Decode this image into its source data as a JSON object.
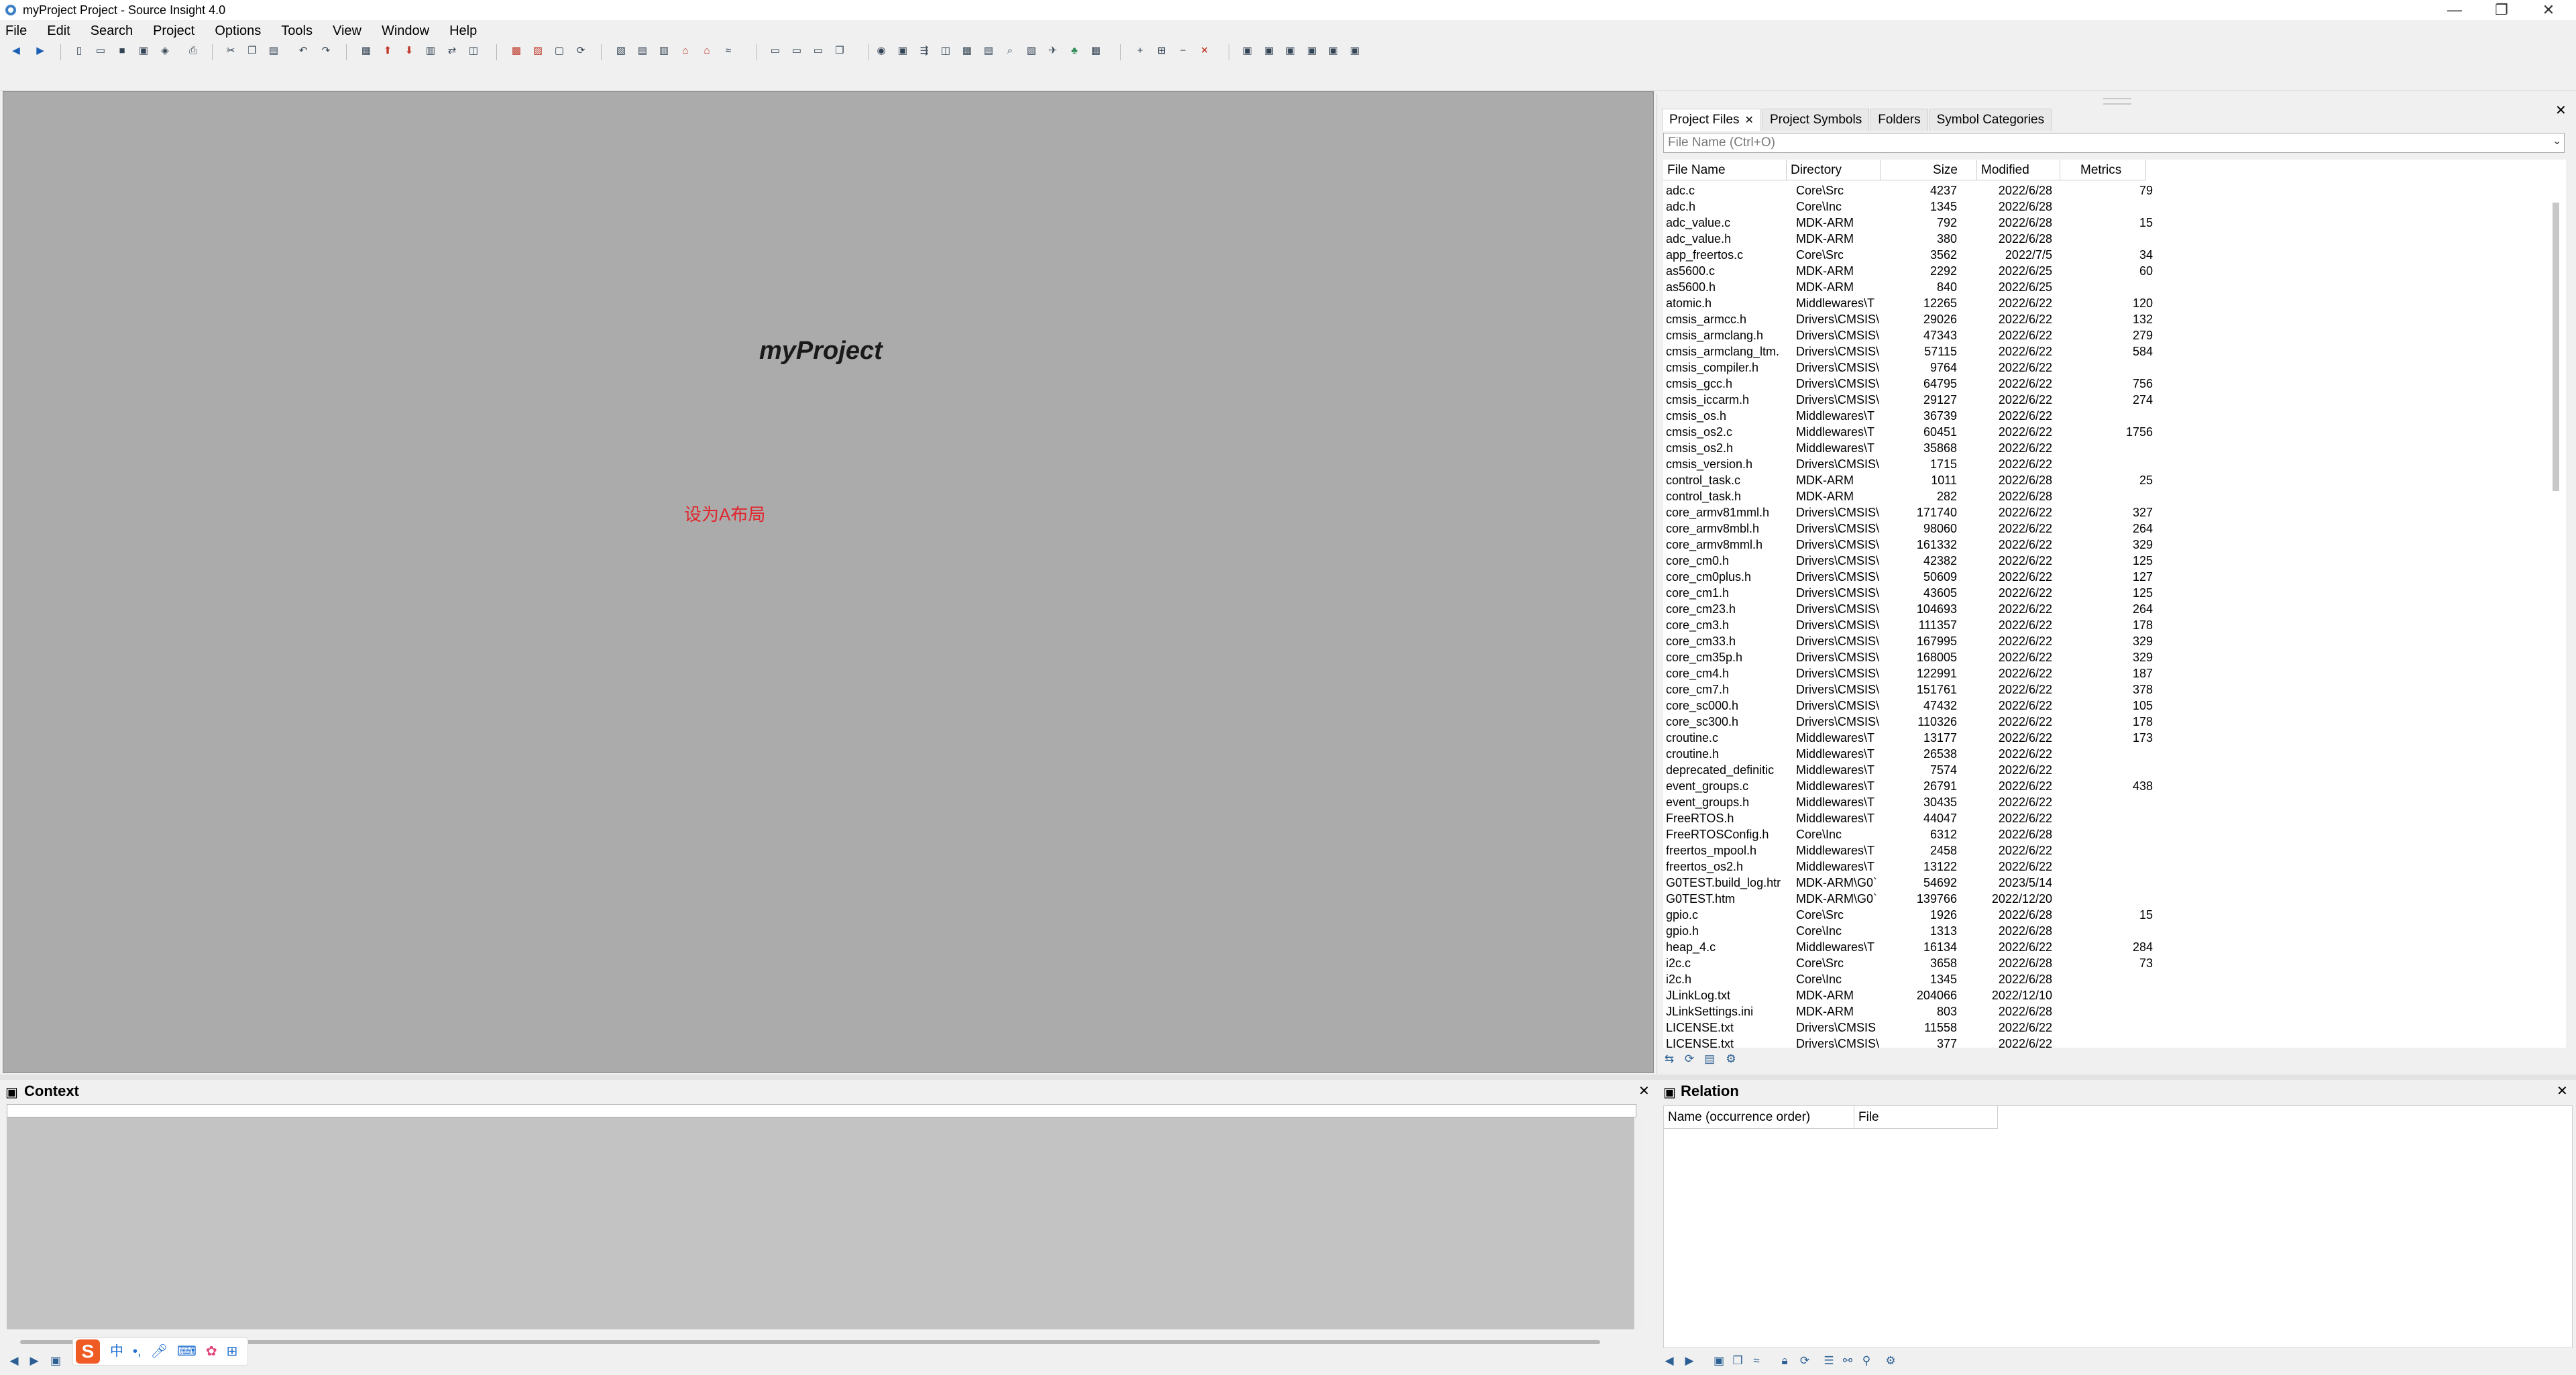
{
  "window": {
    "title": "myProject Project - Source Insight 4.0",
    "controls": {
      "minimize": "—",
      "maximize": "❐",
      "close": "✕"
    }
  },
  "menu": [
    "File",
    "Edit",
    "Search",
    "Project",
    "Options",
    "Tools",
    "View",
    "Window",
    "Help"
  ],
  "editor": {
    "project_name": "myProject",
    "layout_hint": "设为A布局",
    "background": "#ababab",
    "hint_color": "#e1262d"
  },
  "project_window": {
    "tabs": [
      "Project Files",
      "Project Symbols",
      "Folders",
      "Symbol Categories"
    ],
    "active_tab": "Project Files",
    "tab_close": "✕",
    "panel_close": "✕",
    "filter_placeholder": "File Name (Ctrl+O)",
    "columns": [
      "File Name",
      "Directory",
      "Size",
      "Modified",
      "Metrics"
    ],
    "files": [
      {
        "name": "adc.c",
        "dir": "Core\\Src",
        "size": "4237",
        "modified": "2022/6/28",
        "metrics": "79"
      },
      {
        "name": "adc.h",
        "dir": "Core\\Inc",
        "size": "1345",
        "modified": "2022/6/28",
        "metrics": ""
      },
      {
        "name": "adc_value.c",
        "dir": "MDK-ARM",
        "size": "792",
        "modified": "2022/6/28",
        "metrics": "15"
      },
      {
        "name": "adc_value.h",
        "dir": "MDK-ARM",
        "size": "380",
        "modified": "2022/6/28",
        "metrics": ""
      },
      {
        "name": "app_freertos.c",
        "dir": "Core\\Src",
        "size": "3562",
        "modified": "2022/7/5",
        "metrics": "34"
      },
      {
        "name": "as5600.c",
        "dir": "MDK-ARM",
        "size": "2292",
        "modified": "2022/6/25",
        "metrics": "60"
      },
      {
        "name": "as5600.h",
        "dir": "MDK-ARM",
        "size": "840",
        "modified": "2022/6/25",
        "metrics": ""
      },
      {
        "name": "atomic.h",
        "dir": "Middlewares\\T",
        "size": "12265",
        "modified": "2022/6/22",
        "metrics": "120"
      },
      {
        "name": "cmsis_armcc.h",
        "dir": "Drivers\\CMSIS\\",
        "size": "29026",
        "modified": "2022/6/22",
        "metrics": "132"
      },
      {
        "name": "cmsis_armclang.h",
        "dir": "Drivers\\CMSIS\\",
        "size": "47343",
        "modified": "2022/6/22",
        "metrics": "279"
      },
      {
        "name": "cmsis_armclang_ltm.",
        "dir": "Drivers\\CMSIS\\",
        "size": "57115",
        "modified": "2022/6/22",
        "metrics": "584"
      },
      {
        "name": "cmsis_compiler.h",
        "dir": "Drivers\\CMSIS\\",
        "size": "9764",
        "modified": "2022/6/22",
        "metrics": ""
      },
      {
        "name": "cmsis_gcc.h",
        "dir": "Drivers\\CMSIS\\",
        "size": "64795",
        "modified": "2022/6/22",
        "metrics": "756"
      },
      {
        "name": "cmsis_iccarm.h",
        "dir": "Drivers\\CMSIS\\",
        "size": "29127",
        "modified": "2022/6/22",
        "metrics": "274"
      },
      {
        "name": "cmsis_os.h",
        "dir": "Middlewares\\T",
        "size": "36739",
        "modified": "2022/6/22",
        "metrics": ""
      },
      {
        "name": "cmsis_os2.c",
        "dir": "Middlewares\\T",
        "size": "60451",
        "modified": "2022/6/22",
        "metrics": "1756"
      },
      {
        "name": "cmsis_os2.h",
        "dir": "Middlewares\\T",
        "size": "35868",
        "modified": "2022/6/22",
        "metrics": ""
      },
      {
        "name": "cmsis_version.h",
        "dir": "Drivers\\CMSIS\\",
        "size": "1715",
        "modified": "2022/6/22",
        "metrics": ""
      },
      {
        "name": "control_task.c",
        "dir": "MDK-ARM",
        "size": "1011",
        "modified": "2022/6/28",
        "metrics": "25"
      },
      {
        "name": "control_task.h",
        "dir": "MDK-ARM",
        "size": "282",
        "modified": "2022/6/28",
        "metrics": ""
      },
      {
        "name": "core_armv81mml.h",
        "dir": "Drivers\\CMSIS\\",
        "size": "171740",
        "modified": "2022/6/22",
        "metrics": "327"
      },
      {
        "name": "core_armv8mbl.h",
        "dir": "Drivers\\CMSIS\\",
        "size": "98060",
        "modified": "2022/6/22",
        "metrics": "264"
      },
      {
        "name": "core_armv8mml.h",
        "dir": "Drivers\\CMSIS\\",
        "size": "161332",
        "modified": "2022/6/22",
        "metrics": "329"
      },
      {
        "name": "core_cm0.h",
        "dir": "Drivers\\CMSIS\\",
        "size": "42382",
        "modified": "2022/6/22",
        "metrics": "125"
      },
      {
        "name": "core_cm0plus.h",
        "dir": "Drivers\\CMSIS\\",
        "size": "50609",
        "modified": "2022/6/22",
        "metrics": "127"
      },
      {
        "name": "core_cm1.h",
        "dir": "Drivers\\CMSIS\\",
        "size": "43605",
        "modified": "2022/6/22",
        "metrics": "125"
      },
      {
        "name": "core_cm23.h",
        "dir": "Drivers\\CMSIS\\",
        "size": "104693",
        "modified": "2022/6/22",
        "metrics": "264"
      },
      {
        "name": "core_cm3.h",
        "dir": "Drivers\\CMSIS\\",
        "size": "111357",
        "modified": "2022/6/22",
        "metrics": "178"
      },
      {
        "name": "core_cm33.h",
        "dir": "Drivers\\CMSIS\\",
        "size": "167995",
        "modified": "2022/6/22",
        "metrics": "329"
      },
      {
        "name": "core_cm35p.h",
        "dir": "Drivers\\CMSIS\\",
        "size": "168005",
        "modified": "2022/6/22",
        "metrics": "329"
      },
      {
        "name": "core_cm4.h",
        "dir": "Drivers\\CMSIS\\",
        "size": "122991",
        "modified": "2022/6/22",
        "metrics": "187"
      },
      {
        "name": "core_cm7.h",
        "dir": "Drivers\\CMSIS\\",
        "size": "151761",
        "modified": "2022/6/22",
        "metrics": "378"
      },
      {
        "name": "core_sc000.h",
        "dir": "Drivers\\CMSIS\\",
        "size": "47432",
        "modified": "2022/6/22",
        "metrics": "105"
      },
      {
        "name": "core_sc300.h",
        "dir": "Drivers\\CMSIS\\",
        "size": "110326",
        "modified": "2022/6/22",
        "metrics": "178"
      },
      {
        "name": "croutine.c",
        "dir": "Middlewares\\T",
        "size": "13177",
        "modified": "2022/6/22",
        "metrics": "173"
      },
      {
        "name": "croutine.h",
        "dir": "Middlewares\\T",
        "size": "26538",
        "modified": "2022/6/22",
        "metrics": ""
      },
      {
        "name": "deprecated_definitic",
        "dir": "Middlewares\\T",
        "size": "7574",
        "modified": "2022/6/22",
        "metrics": ""
      },
      {
        "name": "event_groups.c",
        "dir": "Middlewares\\T",
        "size": "26791",
        "modified": "2022/6/22",
        "metrics": "438"
      },
      {
        "name": "event_groups.h",
        "dir": "Middlewares\\T",
        "size": "30435",
        "modified": "2022/6/22",
        "metrics": ""
      },
      {
        "name": "FreeRTOS.h",
        "dir": "Middlewares\\T",
        "size": "44047",
        "modified": "2022/6/22",
        "metrics": ""
      },
      {
        "name": "FreeRTOSConfig.h",
        "dir": "Core\\Inc",
        "size": "6312",
        "modified": "2022/6/28",
        "metrics": ""
      },
      {
        "name": "freertos_mpool.h",
        "dir": "Middlewares\\T",
        "size": "2458",
        "modified": "2022/6/22",
        "metrics": ""
      },
      {
        "name": "freertos_os2.h",
        "dir": "Middlewares\\T",
        "size": "13122",
        "modified": "2022/6/22",
        "metrics": ""
      },
      {
        "name": "G0TEST.build_log.htr",
        "dir": "MDK-ARM\\G0`",
        "size": "54692",
        "modified": "2023/5/14",
        "metrics": ""
      },
      {
        "name": "G0TEST.htm",
        "dir": "MDK-ARM\\G0`",
        "size": "139766",
        "modified": "2022/12/20",
        "metrics": ""
      },
      {
        "name": "gpio.c",
        "dir": "Core\\Src",
        "size": "1926",
        "modified": "2022/6/28",
        "metrics": "15"
      },
      {
        "name": "gpio.h",
        "dir": "Core\\Inc",
        "size": "1313",
        "modified": "2022/6/28",
        "metrics": ""
      },
      {
        "name": "heap_4.c",
        "dir": "Middlewares\\T",
        "size": "16134",
        "modified": "2022/6/22",
        "metrics": "284"
      },
      {
        "name": "i2c.c",
        "dir": "Core\\Src",
        "size": "3658",
        "modified": "2022/6/28",
        "metrics": "73"
      },
      {
        "name": "i2c.h",
        "dir": "Core\\Inc",
        "size": "1345",
        "modified": "2022/6/28",
        "metrics": ""
      },
      {
        "name": "JLinkLog.txt",
        "dir": "MDK-ARM",
        "size": "204066",
        "modified": "2022/12/10",
        "metrics": ""
      },
      {
        "name": "JLinkSettings.ini",
        "dir": "MDK-ARM",
        "size": "803",
        "modified": "2022/6/28",
        "metrics": ""
      },
      {
        "name": "LICENSE.txt",
        "dir": "Drivers\\CMSIS",
        "size": "11558",
        "modified": "2022/6/22",
        "metrics": ""
      },
      {
        "name": "LICENSE.txt",
        "dir": "Drivers\\CMSIS\\",
        "size": "377",
        "modified": "2022/6/22",
        "metrics": ""
      }
    ]
  },
  "context_panel": {
    "title": "Context",
    "close": "✕"
  },
  "relation_panel": {
    "title": "Relation",
    "close": "✕",
    "columns": [
      "Name (occurrence order)",
      "File"
    ]
  },
  "ime": {
    "logo": "S",
    "mode": "中"
  }
}
